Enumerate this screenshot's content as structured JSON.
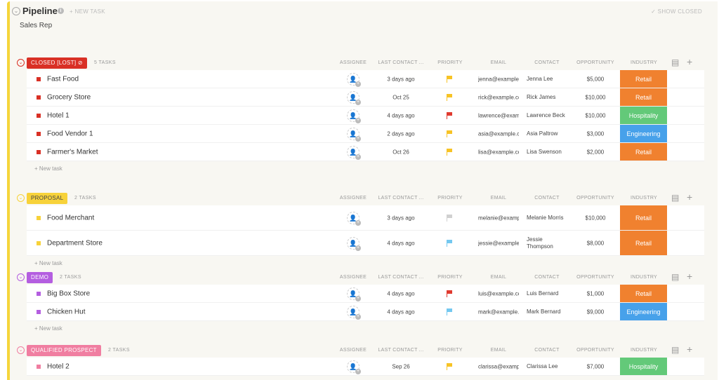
{
  "header": {
    "title": "Pipeline",
    "new_task": "+ NEW TASK",
    "show_closed": "✓ SHOW CLOSED",
    "subtitle": "Sales Rep"
  },
  "columns": [
    "ASSIGNEE",
    "LAST CONTACT ...",
    "PRIORITY",
    "EMAIL",
    "CONTACT",
    "OPPORTUNITY",
    "INDUSTRY"
  ],
  "new_task_label": "+ New task",
  "colors": {
    "Retail": "#f0812f",
    "Hospitality": "#63c979",
    "Engineering": "#47a1ea",
    "flag_yellow": "#f7c325",
    "flag_red": "#e03a2f",
    "flag_gray": "#d0d0d0",
    "flag_blue": "#74c8f0"
  },
  "groups": [
    {
      "status": "CLOSED [LOST] ⊘",
      "count": "5 TASKS",
      "color": "#d93025",
      "text": "#fff",
      "tasks": [
        {
          "name": "Fast Food",
          "last": "3 days ago",
          "priority": "yellow",
          "email": "jenna@example.com",
          "contact": "Jenna Lee",
          "opp": "$5,000",
          "industry": "Retail"
        },
        {
          "name": "Grocery Store",
          "last": "Oct 25",
          "priority": "yellow",
          "email": "rick@example.com",
          "contact": "Rick James",
          "opp": "$10,000",
          "industry": "Retail"
        },
        {
          "name": "Hotel 1",
          "last": "4 days ago",
          "priority": "red",
          "email": "lawrence@example.com",
          "contact": "Lawrence Beck",
          "opp": "$10,000",
          "industry": "Hospitality"
        },
        {
          "name": "Food Vendor 1",
          "last": "2 days ago",
          "priority": "yellow",
          "email": "asia@example.com",
          "contact": "Asia Paltrow",
          "opp": "$3,000",
          "industry": "Engineering"
        },
        {
          "name": "Farmer's Market",
          "last": "Oct 26",
          "priority": "yellow",
          "email": "lisa@example.com",
          "contact": "Lisa Swenson",
          "opp": "$2,000",
          "industry": "Retail"
        }
      ]
    },
    {
      "status": "PROPOSAL",
      "count": "2 TASKS",
      "color": "#f7d23a",
      "text": "#444",
      "tasks": [
        {
          "name": "Food Merchant",
          "last": "3 days ago",
          "priority": "gray",
          "email": "melanie@example.com",
          "contact": "Melanie Morris",
          "opp": "$10,000",
          "industry": "Retail"
        },
        {
          "name": "Department Store",
          "last": "4 days ago",
          "priority": "blue",
          "email": "jessie@example.com",
          "contact": "Jessie Thompson",
          "opp": "$8,000",
          "industry": "Retail"
        }
      ]
    },
    {
      "status": "DEMO",
      "count": "2 TASKS",
      "color": "#b45ee0",
      "text": "#fff",
      "tasks": [
        {
          "name": "Big Box Store",
          "last": "4 days ago",
          "priority": "red",
          "email": "luis@example.com",
          "contact": "Luis Bernard",
          "opp": "$1,000",
          "industry": "Retail"
        },
        {
          "name": "Chicken Hut",
          "last": "4 days ago",
          "priority": "blue",
          "email": "mark@example.com",
          "contact": "Mark Bernard",
          "opp": "$9,000",
          "industry": "Engineering"
        }
      ]
    },
    {
      "status": "QUALIFIED PROSPECT",
      "count": "2 TASKS",
      "color": "#f07ea1",
      "text": "#fff",
      "tasks": [
        {
          "name": "Hotel 2",
          "last": "Sep 26",
          "priority": "yellow",
          "email": "clarissa@example.com",
          "contact": "Clarissa Lee",
          "opp": "$7,000",
          "industry": "Hospitality"
        }
      ]
    }
  ]
}
